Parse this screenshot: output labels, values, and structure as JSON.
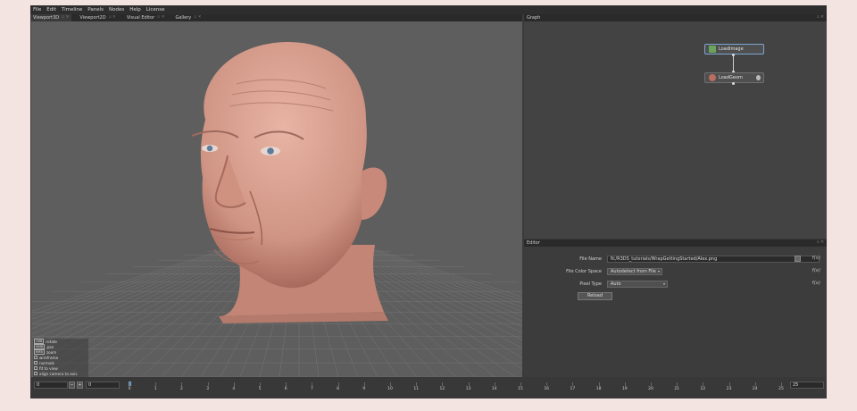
{
  "menu": [
    "File",
    "Edit",
    "Timeline",
    "Panels",
    "Nodes",
    "Help",
    "License"
  ],
  "viewport_tabs": [
    {
      "label": "Viewport3D",
      "active": true
    },
    {
      "label": "Viewport2D",
      "active": false
    },
    {
      "label": "Visual Editor",
      "active": false
    },
    {
      "label": "Gallery",
      "active": false
    }
  ],
  "graph": {
    "title": "Graph",
    "nodes": [
      {
        "label": "LoadImage",
        "icon": "image-icon"
      },
      {
        "label": "LoadGeom",
        "icon": "geometry-icon"
      }
    ]
  },
  "editor": {
    "title": "Editor",
    "file_name_label": "File Name",
    "file_name_value": "N:/R3DS_tutorials/WrapGettingStarted/Alex.png",
    "color_space_label": "File Color Space",
    "color_space_value": "Autodetect from File",
    "pixel_type_label": "Pixel Type",
    "pixel_type_value": "Auto",
    "reload_label": "Reload",
    "fx_label": "f(x)"
  },
  "viewport_overlay": [
    {
      "key": "LMB",
      "label": "rotate"
    },
    {
      "key": "MMB",
      "label": "pan"
    },
    {
      "key": "RMB",
      "label": "zoom"
    },
    {
      "key": "",
      "label": "wireframe"
    },
    {
      "key": "",
      "label": "normals"
    },
    {
      "key": "",
      "label": "fit to view"
    },
    {
      "key": "",
      "label": "align camera to axis"
    }
  ],
  "timeline": {
    "start": "0",
    "current": "0",
    "end": "25",
    "minus": "−",
    "plus": "+",
    "ticks": [
      "0",
      "1",
      "2",
      "3",
      "4",
      "5",
      "6",
      "7",
      "8",
      "9",
      "10",
      "11",
      "12",
      "13",
      "14",
      "15",
      "16",
      "17",
      "18",
      "19",
      "20",
      "21",
      "22",
      "23",
      "24",
      "25"
    ]
  },
  "colors": {
    "viewport_bg": "#5e5e5e",
    "skin": "#c98a7a",
    "grid": "#7a7a7a",
    "selected_node": "#7aa6d0"
  }
}
